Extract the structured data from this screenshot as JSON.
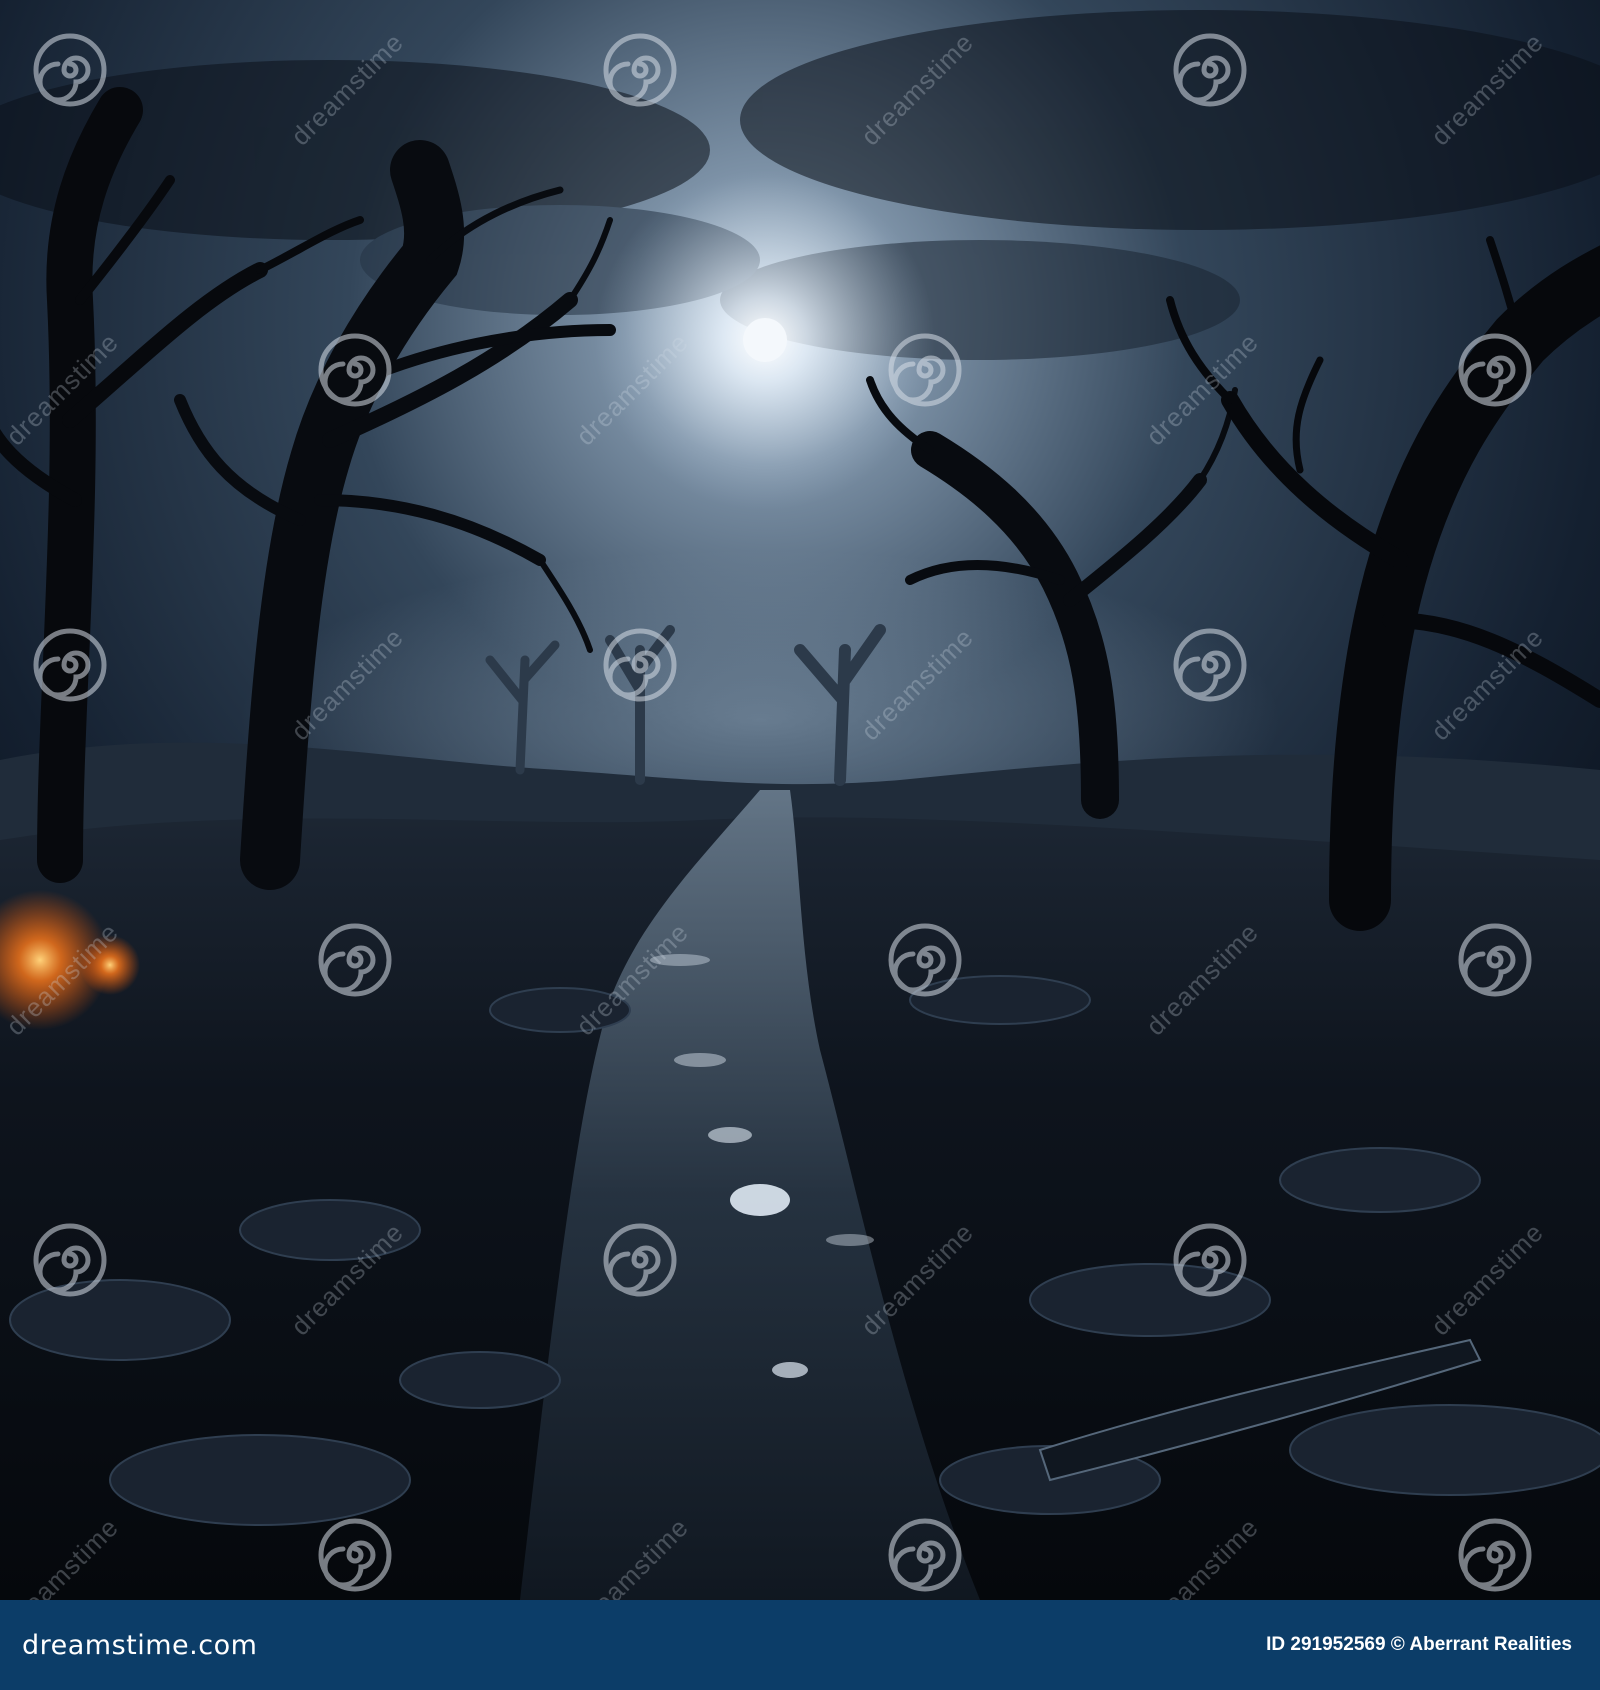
{
  "image": {
    "alt": "Dark misty forest at night with bare twisted trees, full moon behind clouds and a wet rocky path",
    "palette": {
      "sky": "#1a2633",
      "moon": "#e9f2fb",
      "ground": "#0a0e15",
      "glow": "#ff7a1a"
    }
  },
  "watermark": {
    "text": "dreamstime",
    "icon": "spiral-logo"
  },
  "footer": {
    "background": "#0c3d68",
    "brand": "dreamstime.com",
    "credit": "ID 291952569 © Aberrant Realities"
  }
}
